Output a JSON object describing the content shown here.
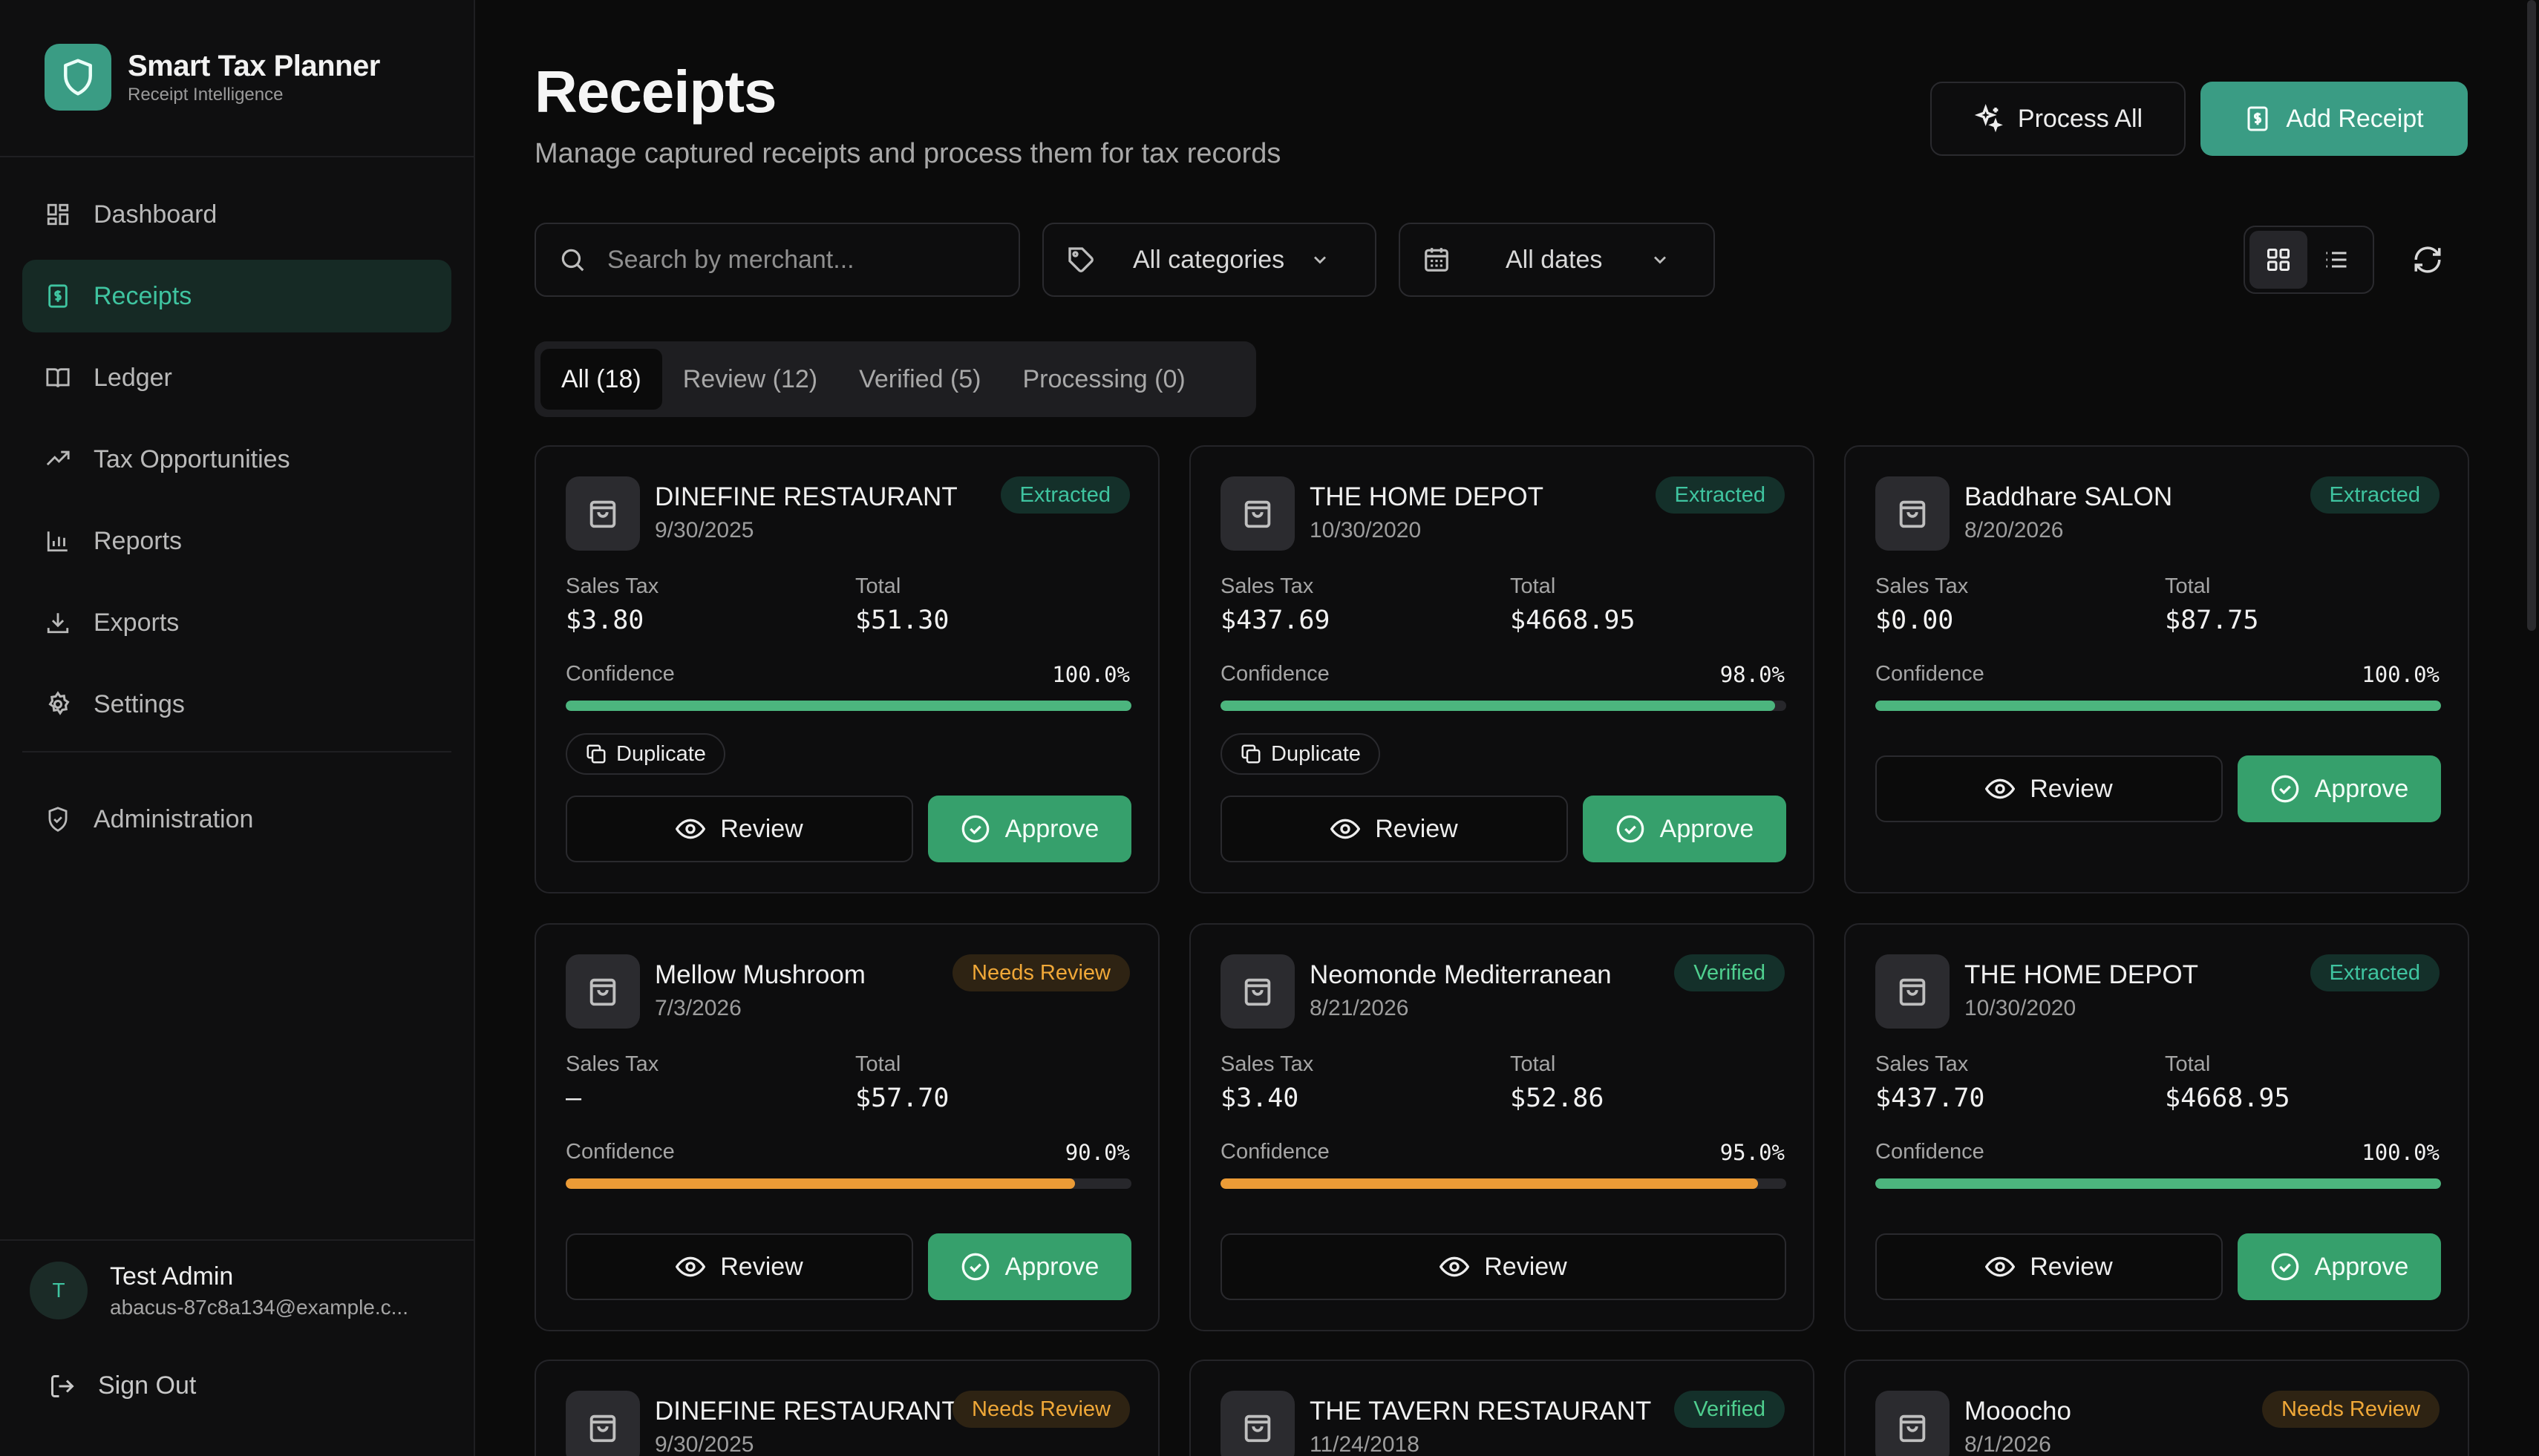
{
  "app": {
    "title": "Smart Tax Planner",
    "subtitle": "Receipt Intelligence",
    "accent": "#3a9c84"
  },
  "sidebar": {
    "items": [
      {
        "label": "Dashboard",
        "icon": "dashboard-icon"
      },
      {
        "label": "Receipts",
        "icon": "receipt-icon",
        "active": true
      },
      {
        "label": "Ledger",
        "icon": "book-icon"
      },
      {
        "label": "Tax Opportunities",
        "icon": "trending-up-icon"
      },
      {
        "label": "Reports",
        "icon": "bar-chart-icon"
      },
      {
        "label": "Exports",
        "icon": "download-icon"
      },
      {
        "label": "Settings",
        "icon": "gear-icon"
      }
    ],
    "admin": {
      "label": "Administration",
      "icon": "shield-icon"
    },
    "user": {
      "initial": "T",
      "name": "Test Admin",
      "email": "abacus-87c8a134@example.c..."
    },
    "signout": "Sign Out"
  },
  "header": {
    "title": "Receipts",
    "subtitle": "Manage captured receipts and process them for tax records",
    "process_all": "Process All",
    "add_receipt": "Add Receipt"
  },
  "filters": {
    "search_placeholder": "Search by merchant...",
    "category": "All categories",
    "date": "All dates"
  },
  "tabs": [
    {
      "label": "All (18)",
      "active": true
    },
    {
      "label": "Review (12)"
    },
    {
      "label": "Verified (5)"
    },
    {
      "label": "Processing (0)"
    }
  ],
  "labels": {
    "sales_tax": "Sales Tax",
    "total": "Total",
    "confidence": "Confidence",
    "duplicate": "Duplicate",
    "review": "Review",
    "approve": "Approve"
  },
  "receipts": [
    {
      "merchant": "DINEFINE RESTAURANT",
      "date": "9/30/2025",
      "status": "Extracted",
      "sales_tax": "$3.80",
      "total": "$51.30",
      "confidence": "100.0%",
      "confidence_value": 100,
      "duplicate": true,
      "approve": true
    },
    {
      "merchant": "THE HOME DEPOT",
      "date": "10/30/2020",
      "status": "Extracted",
      "sales_tax": "$437.69",
      "total": "$4668.95",
      "confidence": "98.0%",
      "confidence_value": 98,
      "duplicate": true,
      "approve": true
    },
    {
      "merchant": "Baddhare SALON",
      "date": "8/20/2026",
      "status": "Extracted",
      "sales_tax": "$0.00",
      "total": "$87.75",
      "confidence": "100.0%",
      "confidence_value": 100,
      "duplicate": false,
      "approve": true
    },
    {
      "merchant": "Mellow Mushroom",
      "date": "7/3/2026",
      "status": "Needs Review",
      "sales_tax": "—",
      "total": "$57.70",
      "confidence": "90.0%",
      "confidence_value": 90,
      "duplicate": false,
      "approve": true
    },
    {
      "merchant": "Neomonde Mediterranean",
      "date": "8/21/2026",
      "status": "Verified",
      "sales_tax": "$3.40",
      "total": "$52.86",
      "confidence": "95.0%",
      "confidence_value": 95,
      "duplicate": false,
      "approve": false
    },
    {
      "merchant": "THE HOME DEPOT",
      "date": "10/30/2020",
      "status": "Extracted",
      "sales_tax": "$437.70",
      "total": "$4668.95",
      "confidence": "100.0%",
      "confidence_value": 100,
      "duplicate": false,
      "approve": true
    },
    {
      "merchant": "DINEFINE RESTAURANT",
      "date": "9/30/2025",
      "status": "Needs Review"
    },
    {
      "merchant": "THE TAVERN RESTAURANT",
      "date": "11/24/2018",
      "status": "Verified"
    },
    {
      "merchant": "Mooocho",
      "date": "8/1/2026",
      "status": "Needs Review"
    }
  ]
}
